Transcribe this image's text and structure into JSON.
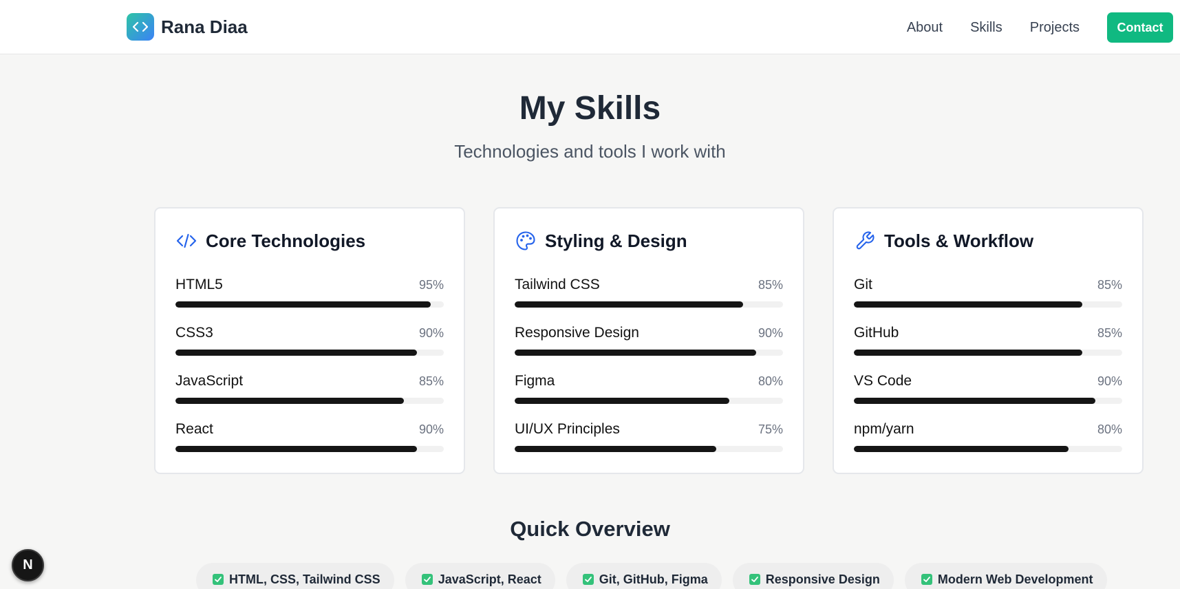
{
  "header": {
    "brand_name": "Rana Diaa",
    "nav": [
      "About",
      "Skills",
      "Projects"
    ],
    "contact_label": "Contact"
  },
  "skills_section": {
    "title": "My Skills",
    "subtitle": "Technologies and tools I work with"
  },
  "cards": [
    {
      "title": "Core Technologies",
      "icon": "code-icon",
      "skills": [
        {
          "name": "HTML5",
          "percent_label": "95%",
          "level": 0.95
        },
        {
          "name": "CSS3",
          "percent_label": "90%",
          "level": 0.9
        },
        {
          "name": "JavaScript",
          "percent_label": "85%",
          "level": 0.85
        },
        {
          "name": "React",
          "percent_label": "90%",
          "level": 0.9
        }
      ]
    },
    {
      "title": "Styling & Design",
      "icon": "palette-icon",
      "skills": [
        {
          "name": "Tailwind CSS",
          "percent_label": "85%",
          "level": 0.85
        },
        {
          "name": "Responsive Design",
          "percent_label": "90%",
          "level": 0.9
        },
        {
          "name": "Figma",
          "percent_label": "80%",
          "level": 0.8
        },
        {
          "name": "UI/UX Principles",
          "percent_label": "75%",
          "level": 0.75
        }
      ]
    },
    {
      "title": "Tools & Workflow",
      "icon": "wrench-icon",
      "skills": [
        {
          "name": "Git",
          "percent_label": "85%",
          "level": 0.85
        },
        {
          "name": "GitHub",
          "percent_label": "85%",
          "level": 0.85
        },
        {
          "name": "VS Code",
          "percent_label": "90%",
          "level": 0.9
        },
        {
          "name": "npm/yarn",
          "percent_label": "80%",
          "level": 0.8
        }
      ]
    }
  ],
  "overview": {
    "title": "Quick Overview",
    "chips": [
      "HTML, CSS, Tailwind CSS",
      "JavaScript, React",
      "Git, GitHub, Figma",
      "Responsive Design",
      "Modern Web Development"
    ]
  },
  "badge": {
    "letter": "N"
  },
  "colors": {
    "accent": "#10b981",
    "bar": "#151515",
    "icon_blue": "#2563eb",
    "check_green": "#34c27a"
  }
}
